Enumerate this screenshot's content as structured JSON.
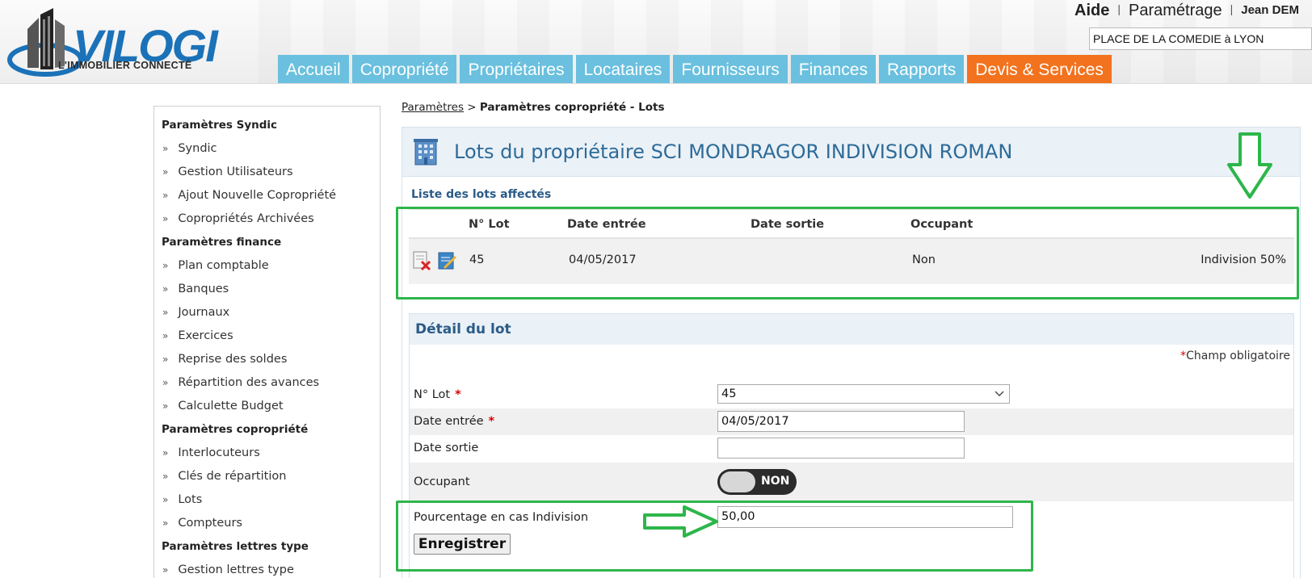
{
  "brand": {
    "name": "VILOGI",
    "tagline": "L'IMMOBILIER CONNECTÉ",
    "accent": "#1b72b8"
  },
  "topbar": {
    "help": "Aide",
    "settings": "Paramétrage",
    "user": "Jean DEM",
    "copropriete": "PLACE DE LA COMEDIE à LYON"
  },
  "nav": [
    {
      "label": "Accueil"
    },
    {
      "label": "Copropriété"
    },
    {
      "label": "Propriétaires"
    },
    {
      "label": "Locataires"
    },
    {
      "label": "Fournisseurs"
    },
    {
      "label": "Finances"
    },
    {
      "label": "Rapports"
    },
    {
      "label": "Devis & Services",
      "color": "#f3721d"
    }
  ],
  "sidebar": {
    "sections": [
      {
        "title": "Paramètres Syndic",
        "items": [
          "Syndic",
          "Gestion Utilisateurs",
          "Ajout Nouvelle Copropriété",
          "Copropriétés Archivées"
        ]
      },
      {
        "title": "Paramètres finance",
        "items": [
          "Plan comptable",
          "Banques",
          "Journaux",
          "Exercices",
          "Reprise des soldes",
          "Répartition des avances",
          "Calculette Budget"
        ]
      },
      {
        "title": "Paramètres copropriété",
        "items": [
          "Interlocuteurs",
          "Clés de répartition",
          "Lots",
          "Compteurs"
        ]
      },
      {
        "title": "Paramètres lettres type",
        "items": [
          "Gestion lettres type"
        ]
      }
    ]
  },
  "breadcrumb": {
    "parent": "Paramètres",
    "separator": ">",
    "current": "Paramètres copropriété - Lots"
  },
  "panel": {
    "title": "Lots du propriétaire SCI MONDRAGOR INDIVISION ROMAN",
    "list_title": "Liste des lots affectés"
  },
  "lots_table": {
    "headers": {
      "lot": "N° Lot",
      "date_in": "Date entrée",
      "date_out": "Date sortie",
      "occupant": "Occupant"
    },
    "rows": [
      {
        "lot": "45",
        "date_in": "04/05/2017",
        "date_out": "",
        "occupant": "Non",
        "share": "Indivision 50%"
      }
    ]
  },
  "detail": {
    "title": "Détail du lot",
    "required_note": "Champ obligatoire",
    "required_mark": "*",
    "fields": {
      "lot_label": "N° Lot",
      "lot_value": "45",
      "date_in_label": "Date entrée",
      "date_in_value": "04/05/2017",
      "date_out_label": "Date sortie",
      "date_out_value": "",
      "occupant_label": "Occupant",
      "occupant_toggle": "NON",
      "percent_label": "Pourcentage en cas Indivision",
      "percent_value": "50,00"
    },
    "save_label": "Enregistrer"
  },
  "annotation_color": "#2db64a"
}
